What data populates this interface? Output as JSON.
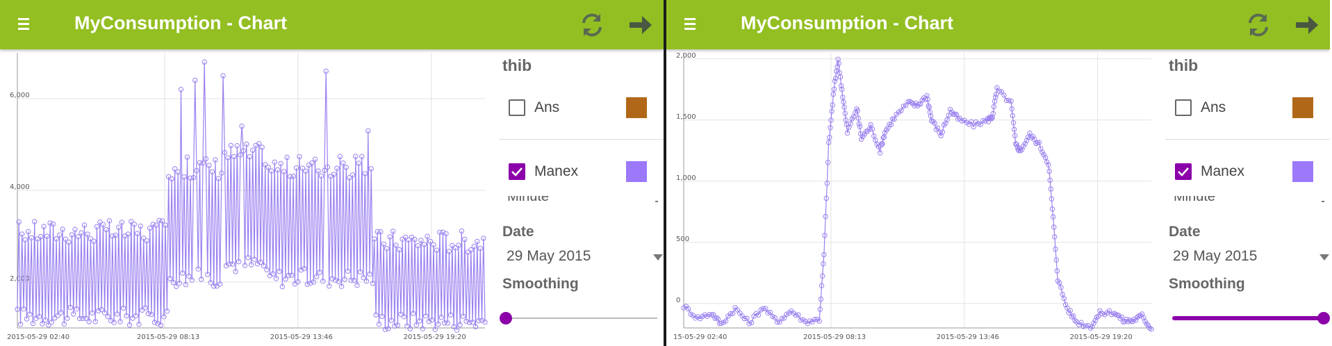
{
  "colors": {
    "appbar": "#93bf22",
    "series": "#9a80f0",
    "accent": "#8b00a8",
    "swatch_ans": "#b06818",
    "swatch_manex": "#9b79fa"
  },
  "screens": [
    {
      "title": "MyConsumption - Chart",
      "icons": {
        "menu": "hamburger-icon",
        "refresh": "refresh-icon",
        "next": "arrow-right-icon"
      },
      "chart_data": {
        "type": "line",
        "title": "",
        "x_tick_labels": [
          "2015-05-29 02:40",
          "2015-05-29 08:13",
          "2015-05-29 13:46",
          "2015-05-29 19:20"
        ],
        "y_tick_labels": [
          "2,000",
          "4,000",
          "6,000"
        ],
        "y_ticks": [
          2000,
          4000,
          6000
        ],
        "ylim": [
          1000,
          7000
        ],
        "grid": true,
        "series": [
          {
            "color": "#9a80f0",
            "smoothing": 0,
            "segments": [
              {
                "from": 0.0,
                "to": 0.32,
                "low": 1250,
                "high": 3100
              },
              {
                "from": 0.32,
                "to": 0.44,
                "low": 2100,
                "high": 4500
              },
              {
                "from": 0.44,
                "to": 0.53,
                "low": 2400,
                "high": 4800
              },
              {
                "from": 0.53,
                "to": 0.76,
                "low": 2100,
                "high": 4500
              },
              {
                "from": 0.76,
                "to": 1.0,
                "low": 1150,
                "high": 2900
              }
            ],
            "spikes": [
              {
                "x": 0.35,
                "value": 6200
              },
              {
                "x": 0.38,
                "value": 6400
              },
              {
                "x": 0.4,
                "value": 6800
              },
              {
                "x": 0.44,
                "value": 6500
              },
              {
                "x": 0.48,
                "value": 5400
              },
              {
                "x": 0.66,
                "value": 6600
              },
              {
                "x": 0.75,
                "value": 5300
              }
            ]
          }
        ]
      },
      "panel": {
        "owner": "thib",
        "datasets": [
          {
            "label": "Ans",
            "checked": false,
            "color": "#b06818"
          },
          {
            "label": "Manex",
            "checked": true,
            "color": "#9b79fa"
          }
        ],
        "clipped_text": "Minute",
        "date_label": "Date",
        "date_value": "29 May 2015",
        "smoothing_label": "Smoothing",
        "smoothing_value": 0
      }
    },
    {
      "title": "MyConsumption - Chart",
      "icons": {
        "menu": "hamburger-icon",
        "refresh": "refresh-icon",
        "next": "arrow-right-icon"
      },
      "chart_data": {
        "type": "line",
        "title": "",
        "x_tick_labels": [
          "15-05-29 02:40",
          "2015-05-29 08:13",
          "2015-05-29 13:46",
          "2015-05-29 19:20"
        ],
        "y_tick_labels": [
          "0",
          "500",
          "1,000",
          "1,500",
          "2,000"
        ],
        "y_ticks": [
          0,
          500,
          1000,
          1500,
          2000
        ],
        "ylim": [
          -200,
          2050
        ],
        "grid": true,
        "series": [
          {
            "color": "#9a80f0",
            "smoothing": 1,
            "points": [
              [
                0.0,
                -20
              ],
              [
                0.03,
                -120
              ],
              [
                0.06,
                -80
              ],
              [
                0.08,
                -170
              ],
              [
                0.11,
                -40
              ],
              [
                0.14,
                -160
              ],
              [
                0.17,
                -30
              ],
              [
                0.2,
                -150
              ],
              [
                0.23,
                -60
              ],
              [
                0.26,
                -150
              ],
              [
                0.29,
                -130
              ],
              [
                0.3,
                400
              ],
              [
                0.31,
                1300
              ],
              [
                0.32,
                1700
              ],
              [
                0.33,
                2000
              ],
              [
                0.34,
                1700
              ],
              [
                0.35,
                1400
              ],
              [
                0.37,
                1600
              ],
              [
                0.38,
                1350
              ],
              [
                0.4,
                1450
              ],
              [
                0.42,
                1250
              ],
              [
                0.43,
                1400
              ],
              [
                0.45,
                1520
              ],
              [
                0.48,
                1640
              ],
              [
                0.5,
                1620
              ],
              [
                0.52,
                1700
              ],
              [
                0.53,
                1500
              ],
              [
                0.55,
                1380
              ],
              [
                0.57,
                1580
              ],
              [
                0.59,
                1500
              ],
              [
                0.62,
                1460
              ],
              [
                0.65,
                1500
              ],
              [
                0.66,
                1530
              ],
              [
                0.67,
                1750
              ],
              [
                0.7,
                1640
              ],
              [
                0.71,
                1300
              ],
              [
                0.72,
                1250
              ],
              [
                0.74,
                1380
              ],
              [
                0.76,
                1300
              ],
              [
                0.78,
                1150
              ],
              [
                0.79,
                700
              ],
              [
                0.8,
                200
              ],
              [
                0.82,
                -40
              ],
              [
                0.84,
                -150
              ],
              [
                0.87,
                -190
              ],
              [
                0.89,
                -80
              ],
              [
                0.92,
                -70
              ],
              [
                0.94,
                -140
              ],
              [
                0.96,
                -140
              ],
              [
                0.98,
                -100
              ],
              [
                1.0,
                -210
              ]
            ]
          }
        ]
      },
      "panel": {
        "owner": "thib",
        "datasets": [
          {
            "label": "Ans",
            "checked": false,
            "color": "#b06818"
          },
          {
            "label": "Manex",
            "checked": true,
            "color": "#9b79fa"
          }
        ],
        "clipped_text": "Minute",
        "date_label": "Date",
        "date_value": "29 May 2015",
        "smoothing_label": "Smoothing",
        "smoothing_value": 1
      }
    }
  ]
}
